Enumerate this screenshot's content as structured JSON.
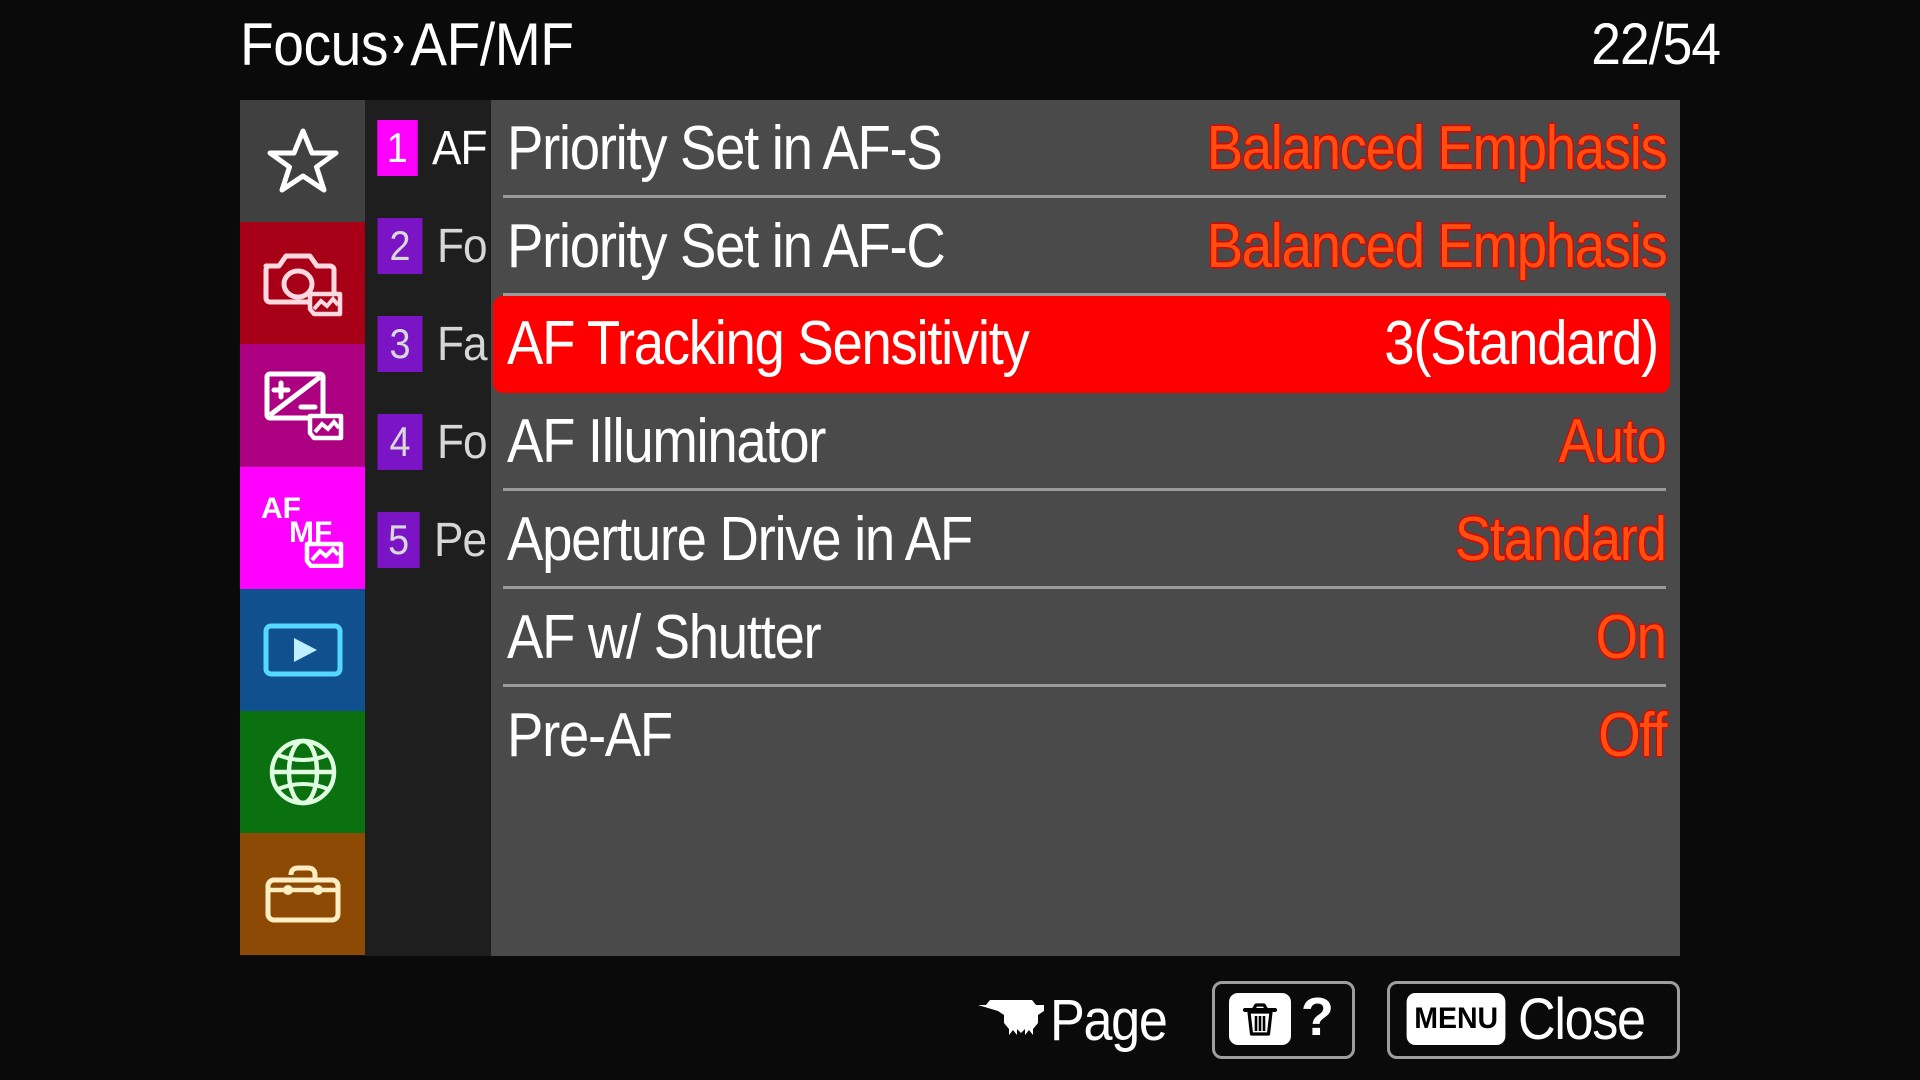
{
  "header": {
    "breadcrumb_root": "Focus",
    "breadcrumb_sep": "›",
    "breadcrumb_current": "AF/MF",
    "page_counter": "22/54"
  },
  "colors": {
    "panel_bg": "#4a4a4a",
    "selected_row_bg": "#ff0000",
    "value_text": "#ff4f10",
    "label_text": "#ffffff",
    "screen_bg": "#0a0a0a",
    "rail_bg": "#141414",
    "tab_col_bg": "#1e1e1e",
    "active_tab": "#ff00ff",
    "inactive_tab": "#7b14c4"
  },
  "icon_rail": {
    "items": [
      {
        "name": "my-menu",
        "icon": "star-icon",
        "bg": "#404040",
        "active": false
      },
      {
        "name": "shooting",
        "icon": "camera-icon",
        "bg": "#a80016",
        "active": false
      },
      {
        "name": "exposure",
        "icon": "exposure-icon",
        "bg": "#ad0080",
        "active": false
      },
      {
        "name": "af-mf",
        "icon": "af-mf-icon",
        "bg": "#ff00ff",
        "active": true
      },
      {
        "name": "playback",
        "icon": "playback-icon",
        "bg": "#10508f",
        "active": false
      },
      {
        "name": "network",
        "icon": "globe-icon",
        "bg": "#0a7010",
        "active": false
      },
      {
        "name": "setup",
        "icon": "toolbox-icon",
        "bg": "#8c4a05",
        "active": false
      }
    ]
  },
  "tabs": {
    "items": [
      {
        "number": "1",
        "label": "AF",
        "active": true
      },
      {
        "number": "2",
        "label": "Fo",
        "active": false
      },
      {
        "number": "3",
        "label": "Fa",
        "active": false
      },
      {
        "number": "4",
        "label": "Fo",
        "active": false
      },
      {
        "number": "5",
        "label": "Pe",
        "active": false
      }
    ]
  },
  "settings": {
    "rows": [
      {
        "label": "Priority Set in AF-S",
        "value": "Balanced Emphasis",
        "selected": false
      },
      {
        "label": "Priority Set in AF-C",
        "value": "Balanced Emphasis",
        "selected": false
      },
      {
        "label": "AF Tracking Sensitivity",
        "value": "3(Standard)",
        "selected": true
      },
      {
        "label": "AF Illuminator",
        "value": "Auto",
        "selected": false
      },
      {
        "label": "Aperture Drive in AF",
        "value": "Standard",
        "selected": false
      },
      {
        "label": "AF w/ Shutter",
        "value": "On",
        "selected": false
      },
      {
        "label": "Pre-AF",
        "value": "Off",
        "selected": false
      }
    ]
  },
  "footer": {
    "page_label": "Page",
    "help_label": "?",
    "menu_badge": "MENU",
    "close_label": "Close"
  }
}
